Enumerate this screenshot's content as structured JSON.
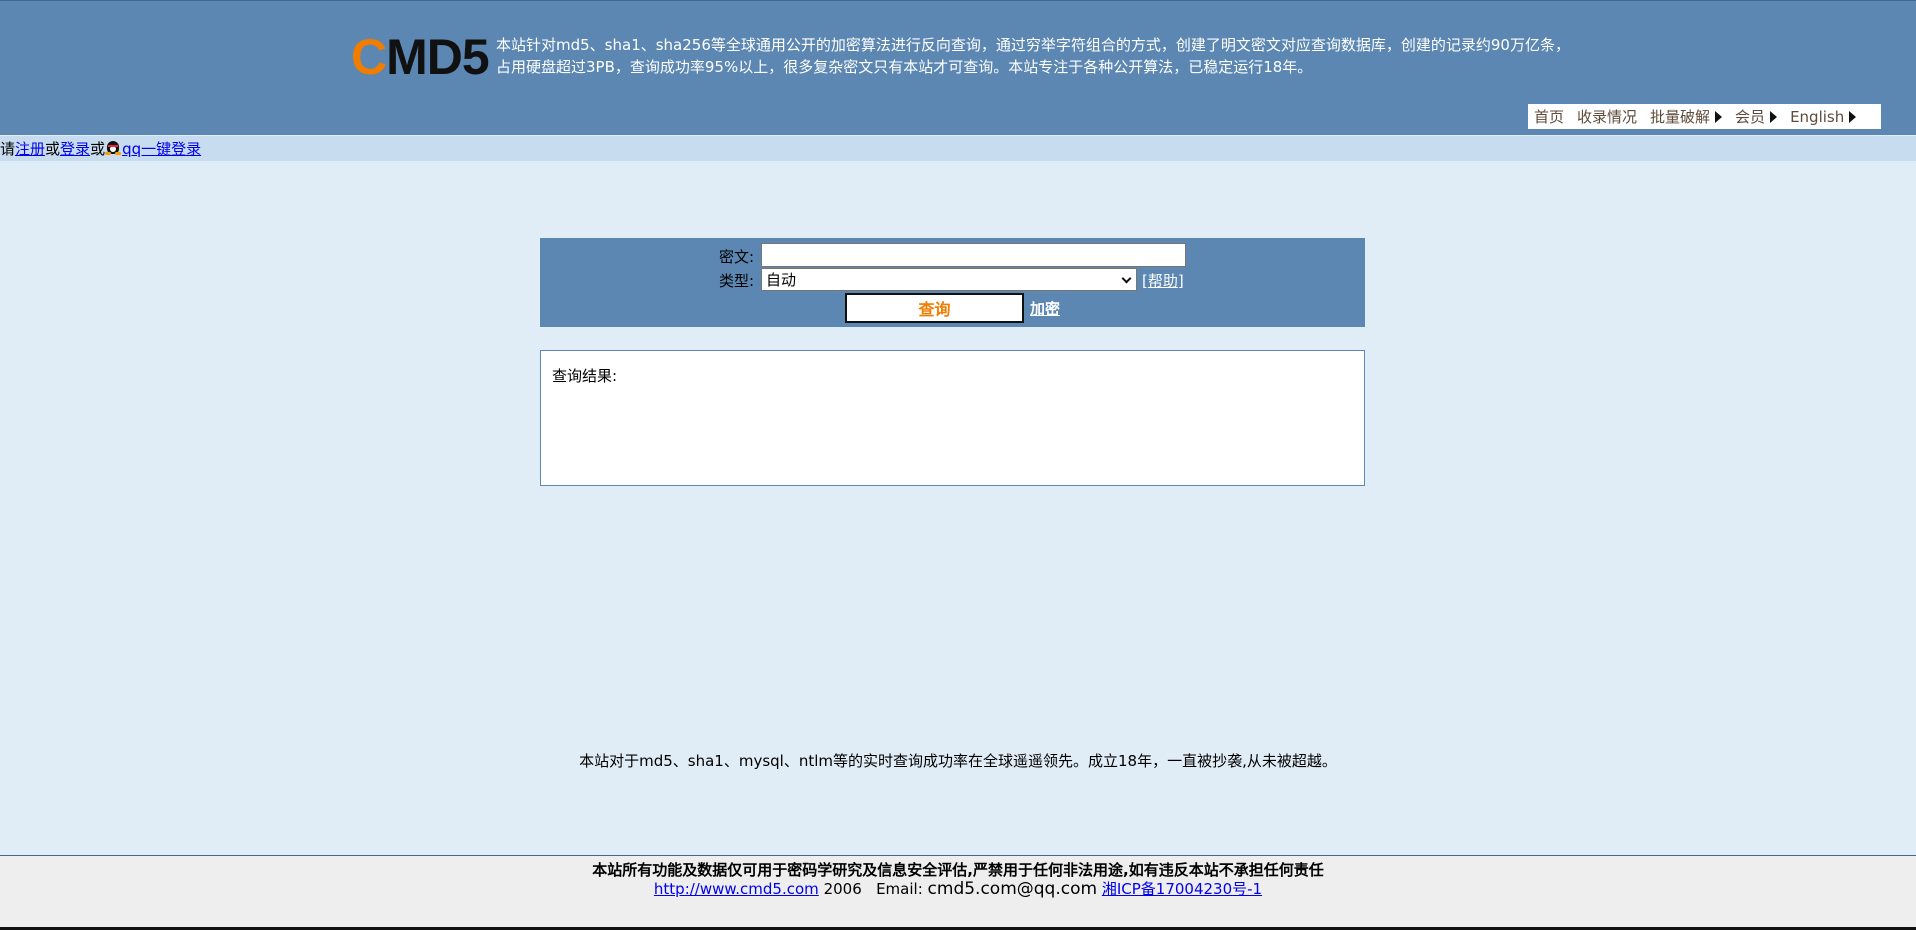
{
  "header": {
    "logo_c": "C",
    "logo_rest": "MD5",
    "desc_line1": "本站针对md5、sha1、sha256等全球通用公开的加密算法进行反向查询，通过穷举字符组合的方式，创建了明文密文对应查询数据库，创建的记录约90万亿条，",
    "desc_line2": "占用硬盘超过3PB，查询成功率95%以上，很多复杂密文只有本站才可查询。本站专注于各种公开算法，已稳定运行18年。",
    "nav": {
      "home": "首页",
      "stats": "收录情况",
      "batch": "批量破解",
      "member": "会员",
      "english": "English"
    }
  },
  "loginbar": {
    "prefix": "请",
    "register": "注册",
    "or1": "或",
    "login": "登录",
    "or2": "或",
    "qq_login": "qq一键登录"
  },
  "form": {
    "cipher_label": "密文:",
    "cipher_value": "",
    "type_label": "类型:",
    "type_selected": "自动",
    "help_open": "[",
    "help": "帮助",
    "help_close": "]",
    "query_button": "查询",
    "encrypt_link": "加密"
  },
  "result": {
    "title": "查询结果:"
  },
  "slogan": "本站对于md5、sha1、mysql、ntlm等的实时查询成功率在全球遥遥领先。成立18年，一直被抄袭,从未被超越。",
  "footer": {
    "disclaimer": "本站所有功能及数据仅可用于密码学研究及信息安全评估,严禁用于任何非法用途,如有违反本站不承担任何责任",
    "site_url": "http://www.cmd5.com",
    "year": "2006",
    "email_label": "Email:",
    "email": "cmd5.com@qq.com",
    "icp": "湘ICP备17004230号-1"
  },
  "colors": {
    "header_bg": "#5b87b2",
    "page_bg": "#e1edf6",
    "accent_orange": "#f07c00"
  }
}
